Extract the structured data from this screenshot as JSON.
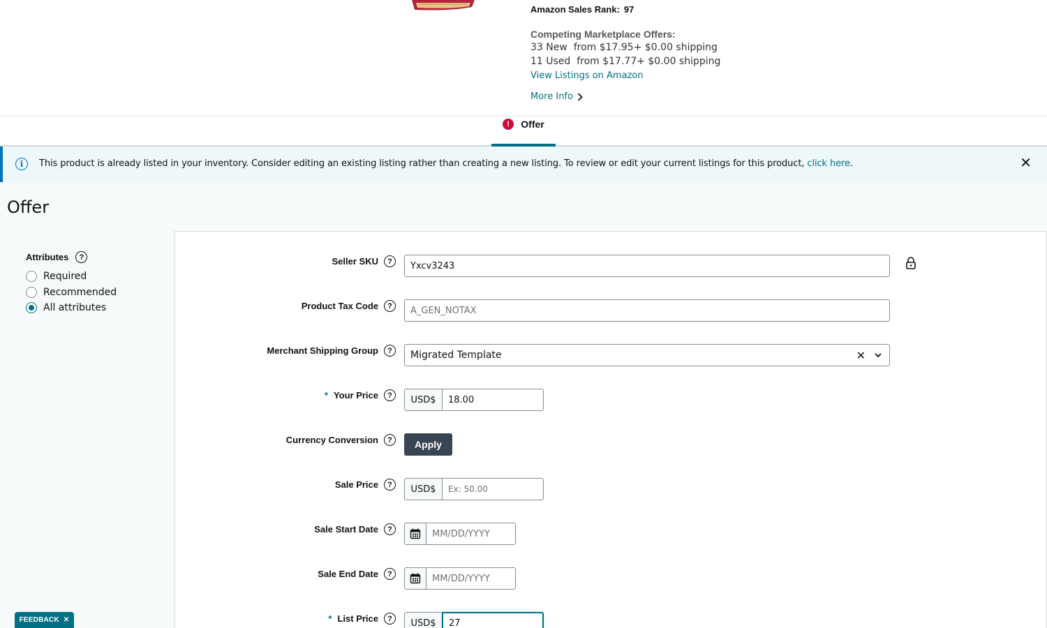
{
  "product": {
    "sales_rank_label": "Amazon Sales Rank:",
    "sales_rank_value": "97",
    "offers_title": "Competing Marketplace Offers:",
    "new_offers": "33 New  from $17.95+ $0.00 shipping",
    "used_offers": "11 Used  from $17.77+ $0.00 shipping",
    "view_listings_link": "View Listings on Amazon",
    "more_info_link": "More Info"
  },
  "tabs": [
    {
      "label": "Offer",
      "has_error": true,
      "active": true,
      "error_mark": "!"
    }
  ],
  "banner": {
    "text": "This product is already listed in your inventory. Consider editing an existing listing rather than creating a new listing. To review or edit your current listings for this product, ",
    "link": "click here",
    "suffix": ".",
    "info_glyph": "i",
    "close_glyph": "✕"
  },
  "page": {
    "title": "Offer"
  },
  "attributes": {
    "label": "Attributes",
    "options": [
      {
        "label": "Required",
        "checked": false
      },
      {
        "label": "Recommended",
        "checked": false
      },
      {
        "label": "All attributes",
        "checked": true
      }
    ]
  },
  "form": {
    "help_glyph": "?",
    "required_mark": "*",
    "seller_sku": {
      "label": "Seller SKU",
      "value": "Yxcv3243"
    },
    "product_tax_code": {
      "label": "Product Tax Code",
      "placeholder": "A_GEN_NOTAX"
    },
    "merchant_shipping_group": {
      "label": "Merchant Shipping Group",
      "value": "Migrated Template",
      "clear_glyph": "✕"
    },
    "your_price": {
      "label": "Your Price",
      "currency": "USD$",
      "value": "18.00",
      "required": true
    },
    "currency_conversion": {
      "label": "Currency Conversion",
      "button": "Apply"
    },
    "sale_price": {
      "label": "Sale Price",
      "currency": "USD$",
      "placeholder": "Ex: 50.00"
    },
    "sale_start_date": {
      "label": "Sale Start Date",
      "placeholder": "MM/DD/YYYY"
    },
    "sale_end_date": {
      "label": "Sale End Date",
      "placeholder": "MM/DD/YYYY"
    },
    "list_price": {
      "label": "List Price",
      "currency": "USD$",
      "value": "27",
      "required": true
    }
  },
  "feedback": {
    "label": "FEEDBACK",
    "close_glyph": "✕"
  },
  "colors": {
    "link": "#007185",
    "error": "#cc0c39",
    "info_bg": "#eef7fa",
    "info_border": "#0073bb",
    "button_dark": "#3a4553"
  }
}
